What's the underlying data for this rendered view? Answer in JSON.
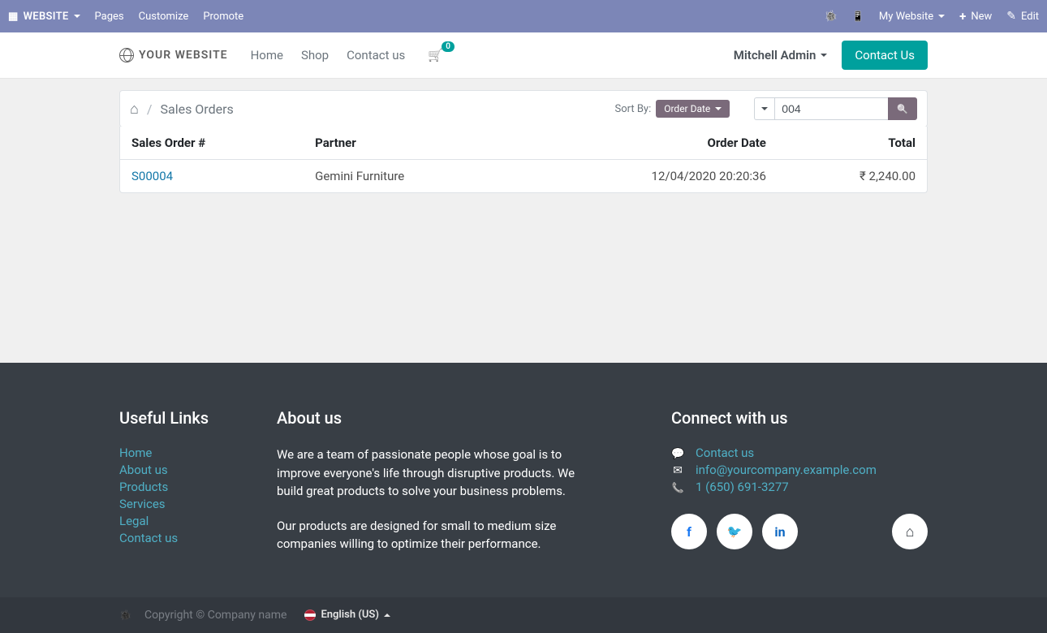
{
  "editor_bar": {
    "website_btn": "WEBSITE",
    "pages": "Pages",
    "customize": "Customize",
    "promote": "Promote",
    "my_website": "My Website",
    "new": "New",
    "edit": "Edit"
  },
  "header": {
    "logo_text": "YOUR WEBSITE",
    "nav": {
      "home": "Home",
      "shop": "Shop",
      "contact": "Contact us"
    },
    "cart_count": "0",
    "user_name": "Mitchell Admin",
    "contact_btn": "Contact Us"
  },
  "breadcrumb": {
    "current": "Sales Orders"
  },
  "sort": {
    "label": "Sort By:",
    "value": "Order Date"
  },
  "search": {
    "value": "004"
  },
  "table": {
    "headers": {
      "order": "Sales Order #",
      "partner": "Partner",
      "date": "Order Date",
      "total": "Total"
    },
    "rows": [
      {
        "order": "S00004",
        "partner": "Gemini Furniture",
        "date": "12/04/2020  20:20:36",
        "total": "₹ 2,240.00"
      }
    ]
  },
  "footer": {
    "useful_title": "Useful Links",
    "links": {
      "home": "Home",
      "about": "About us",
      "products": "Products",
      "services": "Services",
      "legal": "Legal",
      "contact": "Contact us"
    },
    "about_title": "About us",
    "about_p1": "We are a team of passionate people whose goal is to improve everyone's life through disruptive products. We build great products to solve your business problems.",
    "about_p2": "Our products are designed for small to medium size companies willing to optimize their performance.",
    "connect_title": "Connect with us",
    "connect": {
      "contact": "Contact us",
      "email": "info@yourcompany.example.com",
      "phone": "1 (650) 691-3277"
    }
  },
  "bottom": {
    "copyright": "Copyright © Company name",
    "lang": "English (US)"
  }
}
